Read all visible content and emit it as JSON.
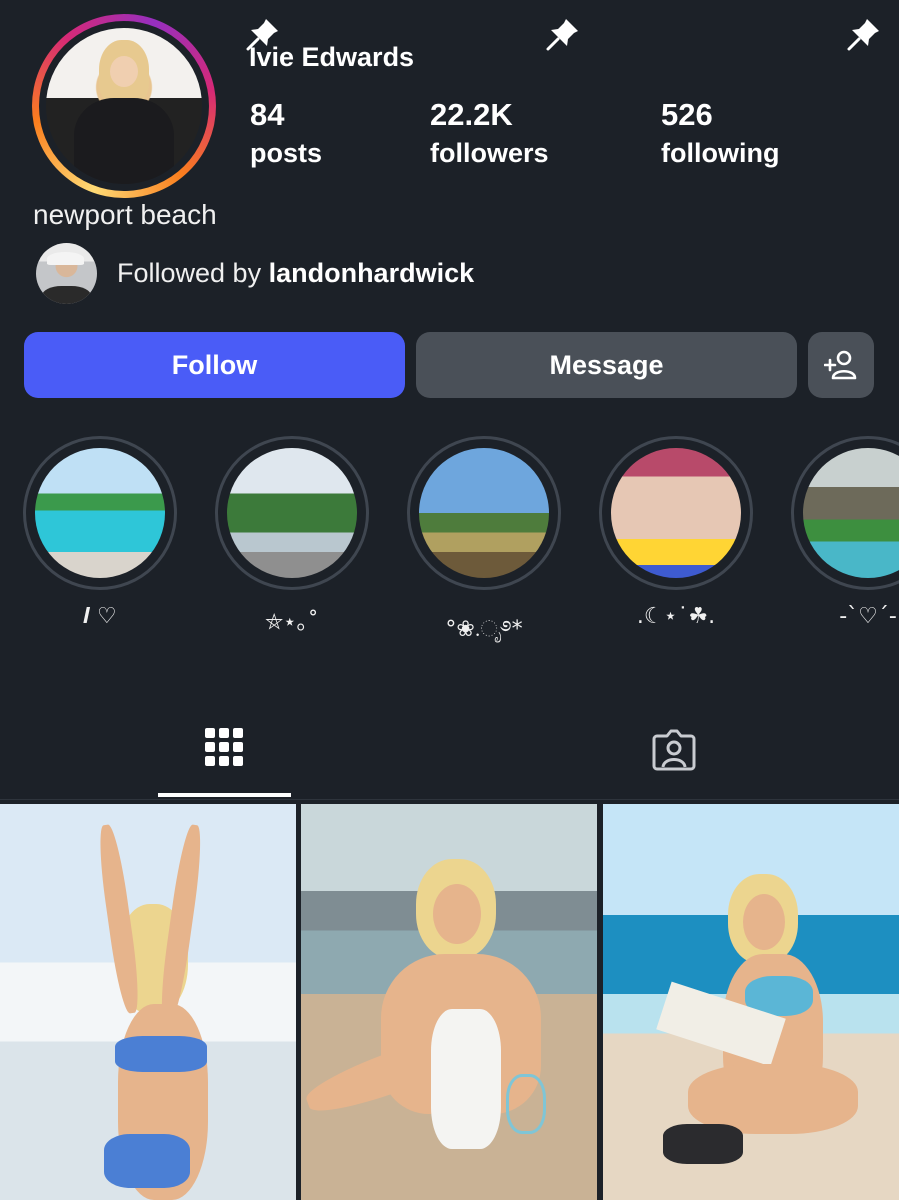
{
  "profile": {
    "username": "Ivie Edwards",
    "bio": "newport beach",
    "stats": {
      "posts_count": "84",
      "posts_label": "posts",
      "followers_count": "22.2K",
      "followers_label": "followers",
      "following_count": "526",
      "following_label": "following"
    },
    "followed_by_prefix": "Followed by ",
    "followed_by_user": "landonhardwick"
  },
  "actions": {
    "follow_label": "Follow",
    "message_label": "Message",
    "add_user_icon": "add-user-icon"
  },
  "highlights": [
    {
      "label": "𝑰 ♡",
      "image": "pool"
    },
    {
      "label": "⛤⋆｡˚",
      "image": "palms"
    },
    {
      "label": "°❀.ೃ࿔*",
      "image": "cliff"
    },
    {
      "label": ".☾⋆˙☘.",
      "image": "family"
    },
    {
      "label": "-ˋ♡ˊ-",
      "image": "resort"
    }
  ],
  "tabs": [
    {
      "name": "posts-grid",
      "icon": "grid-icon",
      "active": true
    },
    {
      "name": "tagged",
      "icon": "tagged-person-icon",
      "active": false
    }
  ],
  "posts": [
    {
      "pinned": true,
      "icon": "pin-icon"
    },
    {
      "pinned": true,
      "icon": "pin-icon"
    },
    {
      "pinned": true,
      "icon": "pin-icon"
    }
  ],
  "colors": {
    "background": "#1c2128",
    "follow_button": "#4a5cf7",
    "secondary_button": "#4a5058"
  }
}
